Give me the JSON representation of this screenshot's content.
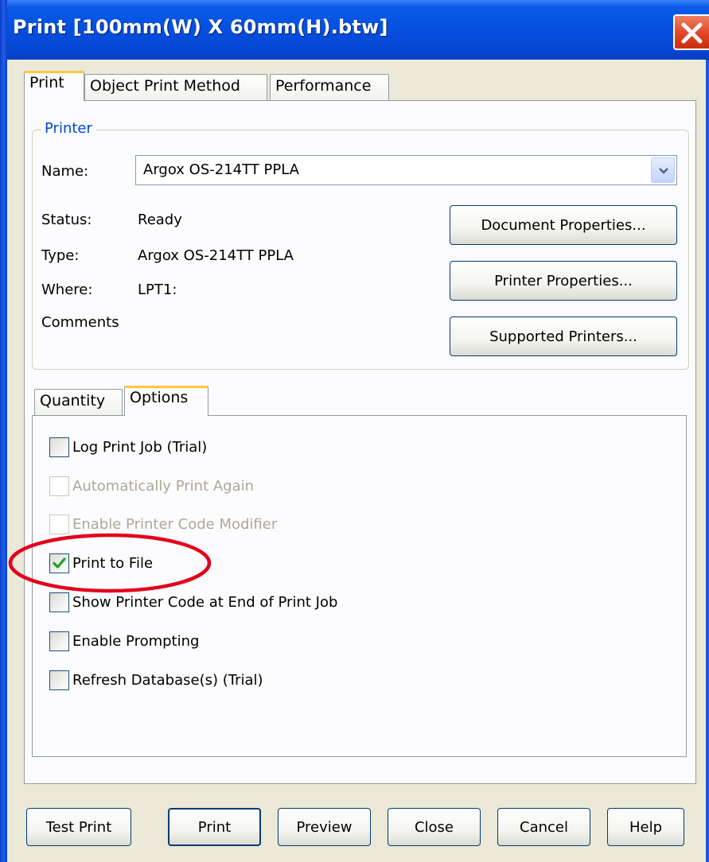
{
  "window": {
    "title": "Print [100mm(W) X 60mm(H).btw]",
    "close_icon": "close-x-icon"
  },
  "top_tabs": [
    "Print",
    "Object Print Method",
    "Performance"
  ],
  "printer_group": {
    "legend": "Printer",
    "name_label": "Name:",
    "name_value": "Argox OS-214TT PPLA",
    "status_label": "Status:",
    "status_value": "Ready",
    "type_label": "Type:",
    "type_value": "Argox OS-214TT PPLA",
    "where_label": "Where:",
    "where_value": "LPT1:",
    "comments_label": "Comments",
    "buttons": {
      "document_properties": "Document Properties...",
      "printer_properties": "Printer Properties...",
      "supported_printers": "Supported Printers..."
    }
  },
  "sub_tabs": [
    "Quantity",
    "Options"
  ],
  "options": [
    {
      "label": "Log Print Job (Trial)",
      "checked": false,
      "enabled": true
    },
    {
      "label": "Automatically Print Again",
      "checked": false,
      "enabled": false
    },
    {
      "label": "Enable Printer Code Modifier",
      "checked": false,
      "enabled": false
    },
    {
      "label": "Print to File",
      "checked": true,
      "enabled": true
    },
    {
      "label": "Show Printer Code at End of Print Job",
      "checked": false,
      "enabled": true
    },
    {
      "label": "Enable Prompting",
      "checked": false,
      "enabled": true
    },
    {
      "label": "Refresh Database(s) (Trial)",
      "checked": false,
      "enabled": true
    }
  ],
  "footer_buttons": {
    "test_print": "Test Print",
    "print": "Print",
    "preview": "Preview",
    "close": "Close",
    "cancel": "Cancel",
    "help": "Help"
  },
  "colors": {
    "titlebar": "#0550e0",
    "tab_active_accent": "#ffc83c",
    "group_legend": "#0046d5",
    "highlight_ring": "#e3001b",
    "checkmark": "#21a121"
  }
}
